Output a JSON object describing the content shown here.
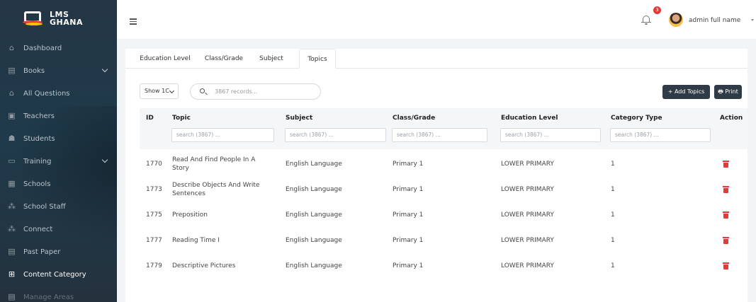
{
  "brand": {
    "line1": "LMS",
    "line2": "GHANA"
  },
  "sidebar": {
    "items": [
      {
        "label": "Dashboard",
        "icon": "home-icon",
        "glyph": "⌂"
      },
      {
        "label": "Books",
        "icon": "book-icon",
        "glyph": "▤",
        "expandable": true
      },
      {
        "label": "All Questions",
        "icon": "home-icon",
        "glyph": "⌂"
      },
      {
        "label": "Teachers",
        "icon": "teacher-icon",
        "glyph": "▣"
      },
      {
        "label": "Students",
        "icon": "students-icon",
        "glyph": "☗"
      },
      {
        "label": "Training",
        "icon": "training-icon",
        "glyph": "▭",
        "expandable": true
      },
      {
        "label": "Schools",
        "icon": "school-icon",
        "glyph": "▦"
      },
      {
        "label": "School Staff",
        "icon": "staff-icon",
        "glyph": "⁂"
      },
      {
        "label": "Connect",
        "icon": "connect-icon",
        "glyph": "⁂"
      },
      {
        "label": "Past Paper",
        "icon": "paper-icon",
        "glyph": "▤"
      },
      {
        "label": "Content Category",
        "icon": "grid-icon",
        "glyph": "⊞",
        "active": true
      },
      {
        "label": "Manage Areas",
        "icon": "map-icon",
        "glyph": "▤"
      }
    ]
  },
  "topbar": {
    "notification_count": "3",
    "user_name": "admin full name"
  },
  "tabs": [
    "Education Level",
    "Class/Grade",
    "Subject",
    "Topics"
  ],
  "active_tab": "Topics",
  "toolbar": {
    "show_label": "Show 1C",
    "search_placeholder": "3867 records...",
    "add_label": "+ Add Topics",
    "print_label": "🖶 Print"
  },
  "table": {
    "columns": [
      "ID",
      "Topic",
      "Subject",
      "Class/Grade",
      "Education Level",
      "Category Type",
      "Action"
    ],
    "filter_placeholder": "search (3867) ...",
    "rows": [
      {
        "id": "1770",
        "topic": "Read And Find People In A Story",
        "subject": "English Language",
        "grade": "Primary 1",
        "level": "LOWER PRIMARY",
        "category": "1"
      },
      {
        "id": "1773",
        "topic": "Describe Objects And Write Sentences",
        "subject": "English Language",
        "grade": "Primary 1",
        "level": "LOWER PRIMARY",
        "category": "1"
      },
      {
        "id": "1775",
        "topic": "Preposition",
        "subject": "English Language",
        "grade": "Primary 1",
        "level": "LOWER PRIMARY",
        "category": "1"
      },
      {
        "id": "1777",
        "topic": "Reading Time I",
        "subject": "English Language",
        "grade": "Primary 1",
        "level": "LOWER PRIMARY",
        "category": "1"
      },
      {
        "id": "1779",
        "topic": "Descriptive Pictures",
        "subject": "English Language",
        "grade": "Primary 1",
        "level": "LOWER PRIMARY",
        "category": "1"
      }
    ]
  },
  "colors": {
    "sidebar": "#243645",
    "primary_button": "#2f3b46",
    "delete": "#e53935",
    "badge": "#e53935"
  }
}
